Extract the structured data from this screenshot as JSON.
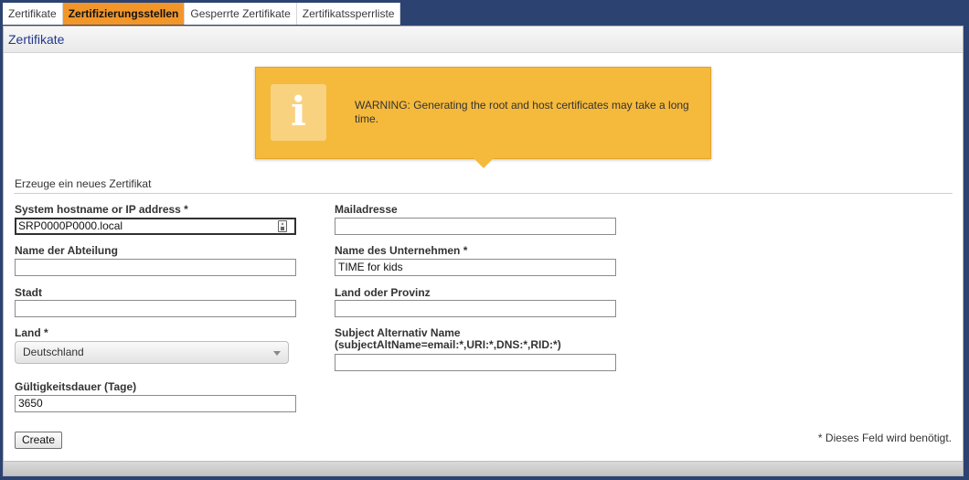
{
  "tabs": [
    {
      "label": "Zertifikate",
      "active": false
    },
    {
      "label": "Zertifizierungsstellen",
      "active": true
    },
    {
      "label": "Gesperrte Zertifikate",
      "active": false
    },
    {
      "label": "Zertifikatssperrliste",
      "active": false
    }
  ],
  "panel": {
    "title": "Zertifikate"
  },
  "warning": {
    "icon": "info-icon",
    "icon_glyph": "i",
    "text": "WARNING: Generating the root and host certificates may take a long time."
  },
  "form": {
    "section_title": "Erzeuge ein neues Zertifikat",
    "hostname": {
      "label": "System hostname or IP address *",
      "value": "SRP0000P0000.local"
    },
    "department": {
      "label": "Name der Abteilung",
      "value": ""
    },
    "city": {
      "label": "Stadt",
      "value": ""
    },
    "country": {
      "label": "Land *",
      "value": "Deutschland"
    },
    "validity": {
      "label": "Gültigkeitsdauer (Tage)",
      "value": "3650"
    },
    "email": {
      "label": "Mailadresse",
      "value": ""
    },
    "company": {
      "label": "Name des Unternehmen *",
      "value": "TIME for kids"
    },
    "state": {
      "label": "Land oder Provinz",
      "value": ""
    },
    "san": {
      "label_line1": "Subject Alternativ Name",
      "label_line2": "(subjectAltName=email:*,URI:*,DNS:*,RID:*)",
      "value": ""
    },
    "create_label": "Create",
    "required_note": "* Dieses Feld wird benötigt."
  },
  "colors": {
    "accent": "#f2962a",
    "warning": "#f5b93b",
    "title": "#24388f",
    "background": "#2c4372"
  }
}
